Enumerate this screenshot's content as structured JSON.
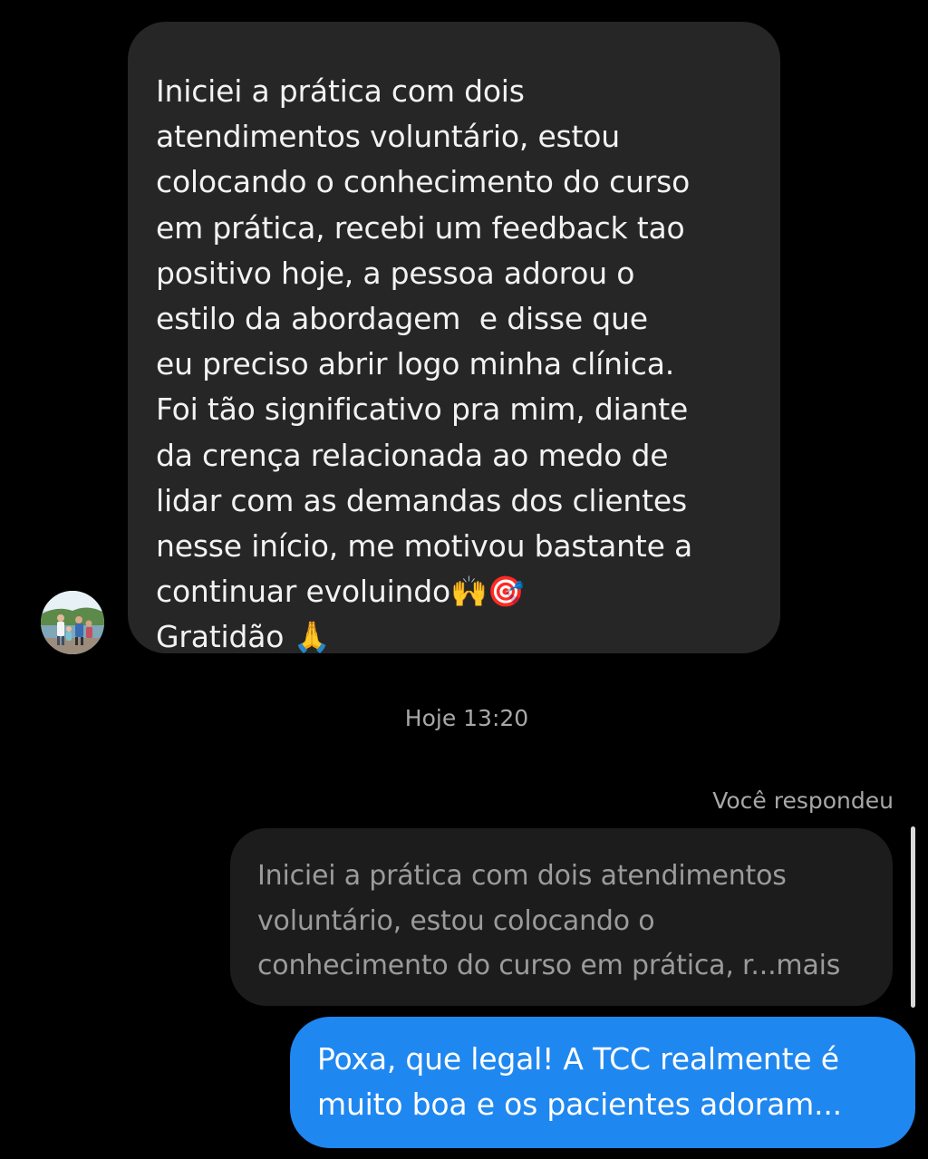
{
  "incoming_message": {
    "lines": [
      "Iniciei a prática com dois",
      "atendimentos voluntário, estou",
      "colocando o conhecimento do curso",
      "em prática, recebi um feedback tao",
      "positivo hoje, a pessoa adorou o",
      "estilo da abordagem  e disse que",
      "eu preciso abrir logo minha clínica.",
      "Foi tão significativo pra mim, diante",
      "da crença relacionada ao medo de",
      "lidar com as demandas dos clientes",
      "nesse início, me motivou bastante a",
      "continuar evoluindo🙌🎯",
      "Gratidão 🙏"
    ]
  },
  "timestamp": "Hoje 13:20",
  "reply_label": "Você respondeu",
  "quoted_message": {
    "lines": [
      "Iniciei a prática com dois atendimentos",
      "voluntário, estou colocando o",
      "conhecimento do curso em prática, r...mais"
    ]
  },
  "outgoing_message": {
    "lines": [
      "Poxa, que legal! A TCC realmente é",
      "muito boa e os pacientes adoram..."
    ]
  },
  "colors": {
    "background": "#000000",
    "incoming_bubble": "#262626",
    "quoted_bubble": "#1c1c1c",
    "outgoing_bubble": "#1f87f0",
    "meta_text": "#a8a8a8"
  }
}
